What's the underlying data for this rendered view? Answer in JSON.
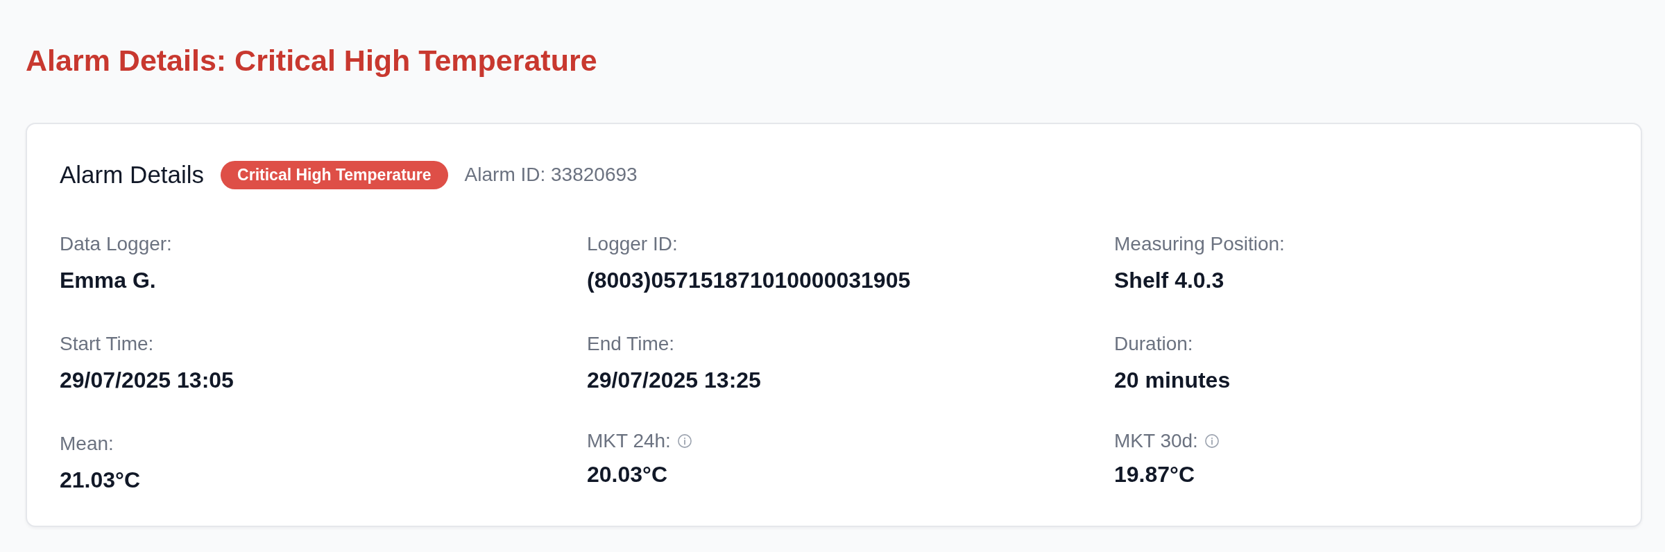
{
  "page": {
    "title": "Alarm Details: Critical High Temperature"
  },
  "card": {
    "title": "Alarm Details",
    "badge": "Critical High Temperature",
    "alarm_id": "Alarm ID: 33820693",
    "fields": [
      {
        "label": "Data Logger:",
        "value": "Emma G.",
        "info": false
      },
      {
        "label": "Logger ID:",
        "value": "(8003)057151871010000031905",
        "info": false
      },
      {
        "label": "Measuring Position:",
        "value": "Shelf 4.0.3",
        "info": false
      },
      {
        "label": "Start Time:",
        "value": "29/07/2025 13:05",
        "info": false
      },
      {
        "label": "End Time:",
        "value": "29/07/2025 13:25",
        "info": false
      },
      {
        "label": "Duration:",
        "value": "20 minutes",
        "info": false
      },
      {
        "label": "Mean:",
        "value": "21.03°C",
        "info": false
      },
      {
        "label": "MKT 24h:",
        "value": "20.03°C",
        "info": true
      },
      {
        "label": "MKT 30d:",
        "value": "19.87°C",
        "info": true
      }
    ]
  }
}
